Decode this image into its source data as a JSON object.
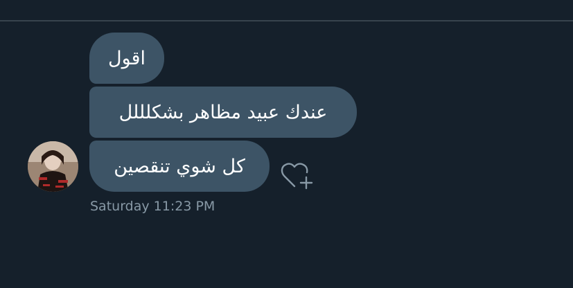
{
  "conversation": {
    "messages": [
      {
        "text": "اقول"
      },
      {
        "text": "عندك عبيد مظاهر بشكلللل"
      },
      {
        "text": "كل شوي تنقصين"
      }
    ],
    "timestamp": "Saturday 11:23 PM",
    "icons": {
      "avatar": "user-avatar",
      "react": "heart-plus-icon"
    }
  },
  "colors": {
    "background": "#15202b",
    "bubble": "#3d5466",
    "bubble_text": "#ffffff",
    "timestamp_text": "#8899a6",
    "divider": "#38444d"
  }
}
